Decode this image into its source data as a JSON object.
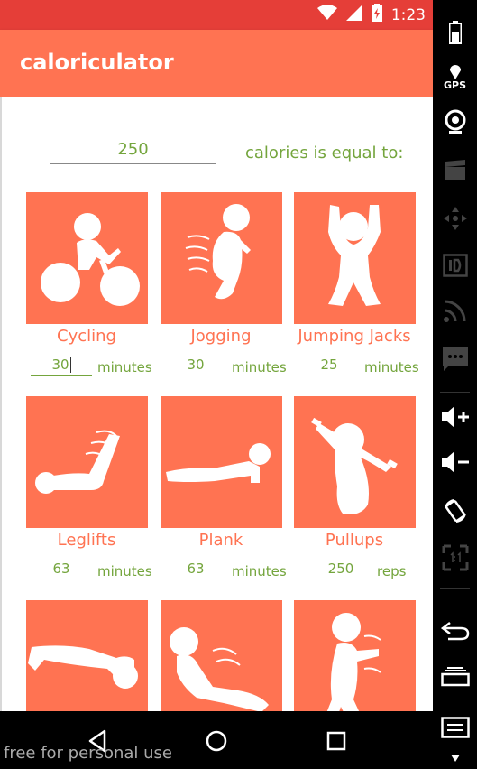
{
  "status_bar": {
    "time": "1:23"
  },
  "app_bar": {
    "title": "caloriculator"
  },
  "calories": {
    "value": "250",
    "label": "calories is equal to:"
  },
  "exercises": [
    {
      "name": "Cycling",
      "value": "30",
      "unit": "minutes",
      "icon": "cycling-icon"
    },
    {
      "name": "Jogging",
      "value": "30",
      "unit": "minutes",
      "icon": "jogging-icon"
    },
    {
      "name": "Jumping Jacks",
      "value": "25",
      "unit": "minutes",
      "icon": "jumping-jacks-icon"
    },
    {
      "name": "Leglifts",
      "value": "63",
      "unit": "minutes",
      "icon": "leglifts-icon"
    },
    {
      "name": "Plank",
      "value": "63",
      "unit": "minutes",
      "icon": "plank-icon"
    },
    {
      "name": "Pullups",
      "value": "250",
      "unit": "reps",
      "icon": "pullups-icon"
    }
  ],
  "watermark": "free for personal use",
  "emulator_toolbar": {
    "gps_label": "GPS"
  },
  "colors": {
    "status_bar": "#E53E38",
    "app_bar": "#FF7352",
    "accent": "#74A53D",
    "card": "#FF7352"
  }
}
